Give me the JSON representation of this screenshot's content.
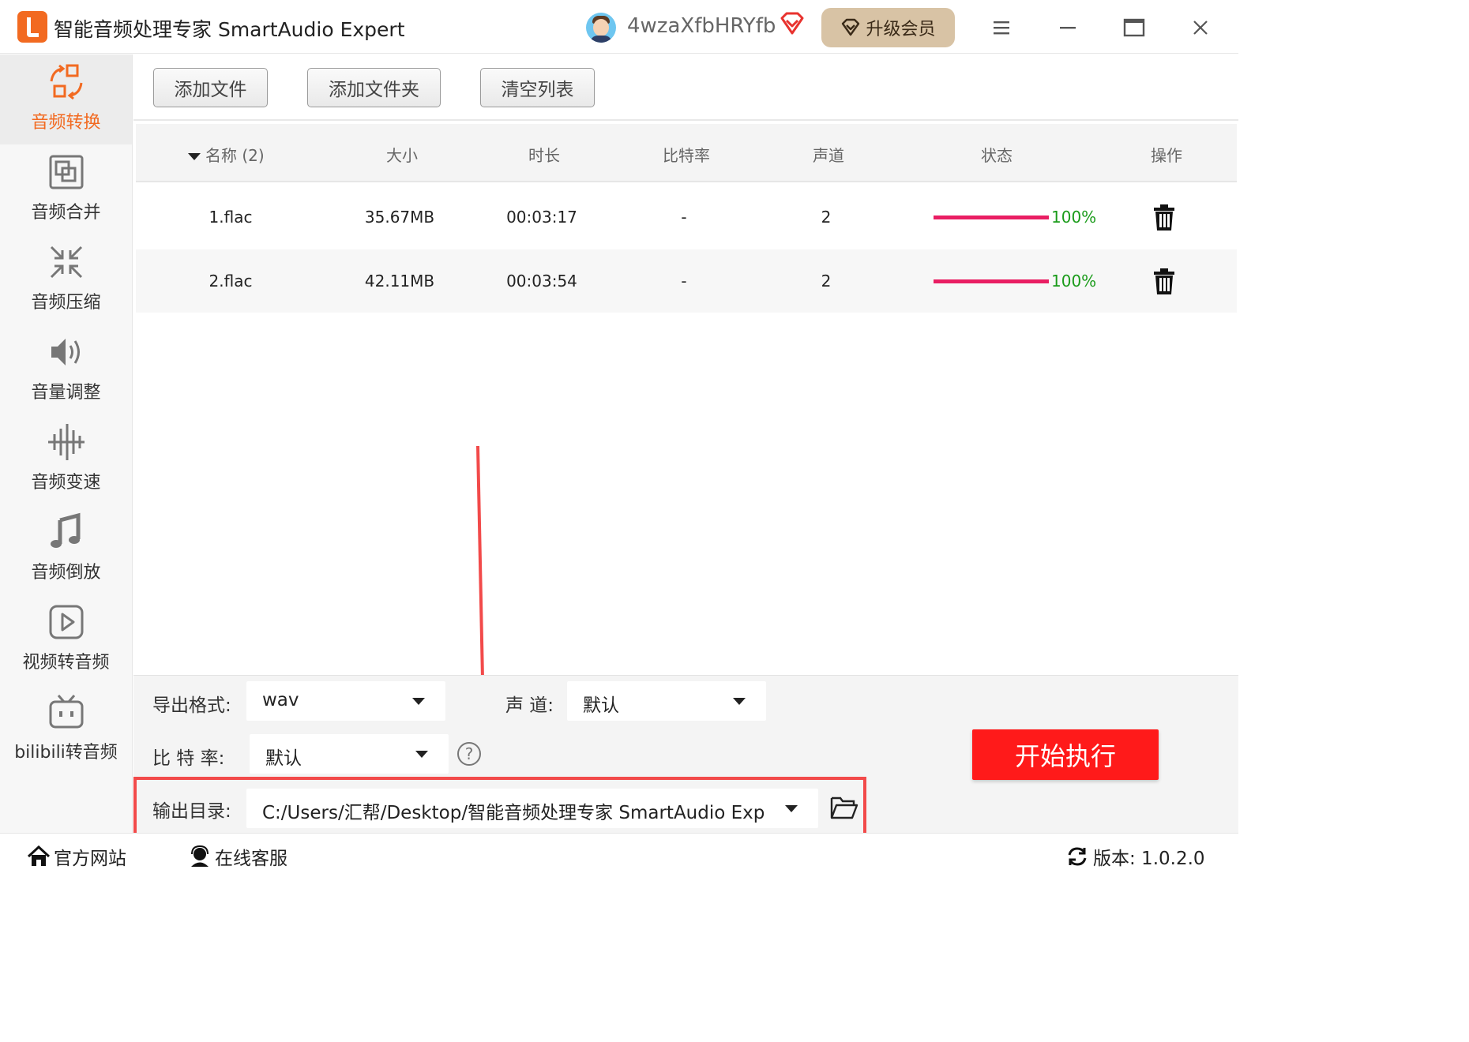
{
  "titlebar": {
    "app_title": "智能音频处理专家 SmartAudio Expert",
    "username": "4wzaXfbHRYfb",
    "upgrade_label": "升级会员"
  },
  "sidebar": {
    "items": [
      {
        "label": "音频转换",
        "icon": "convert-icon",
        "active": true
      },
      {
        "label": "音频合并",
        "icon": "merge-icon"
      },
      {
        "label": "音频压缩",
        "icon": "compress-icon"
      },
      {
        "label": "音量调整",
        "icon": "volume-icon"
      },
      {
        "label": "音频变速",
        "icon": "speed-icon"
      },
      {
        "label": "音频倒放",
        "icon": "music-note-icon"
      },
      {
        "label": "视频转音频",
        "icon": "video-play-icon"
      },
      {
        "label": "bilibili转音频",
        "icon": "bilibili-tv-icon"
      }
    ]
  },
  "toolbar": {
    "add_file": "添加文件",
    "add_folder": "添加文件夹",
    "clear_list": "清空列表"
  },
  "table": {
    "columns": [
      "名称 (2)",
      "大小",
      "时长",
      "比特率",
      "声道",
      "状态",
      "操作"
    ],
    "rows": [
      {
        "name": "1.flac",
        "size": "35.67MB",
        "duration": "00:03:17",
        "bitrate": "-",
        "channels": "2",
        "progress": 1.0,
        "progress_text": "100%"
      },
      {
        "name": "2.flac",
        "size": "42.11MB",
        "duration": "00:03:54",
        "bitrate": "-",
        "channels": "2",
        "progress": 1.0,
        "progress_text": "100%"
      }
    ]
  },
  "settings": {
    "format_label": "导出格式:",
    "format_value": "wav",
    "channel_label": "声 道:",
    "channel_value": "默认",
    "bitrate_label": "比 特 率:",
    "bitrate_value": "默认",
    "help": "?",
    "output_label": "输出目录:",
    "output_value": "C:/Users/汇帮/Desktop/智能音频处理专家 SmartAudio Exp",
    "start_label": "开始执行"
  },
  "footer": {
    "website": "官方网站",
    "support": "在线客服",
    "version": "版本:  1.0.2.0"
  },
  "colors": {
    "accent": "#f26a21",
    "progress": "#e91e63",
    "success_text": "#1a9b1a",
    "start_button": "#ff1a1a",
    "highlight": "#f24a4a",
    "upgrade_bg": "#d8c3a5"
  }
}
